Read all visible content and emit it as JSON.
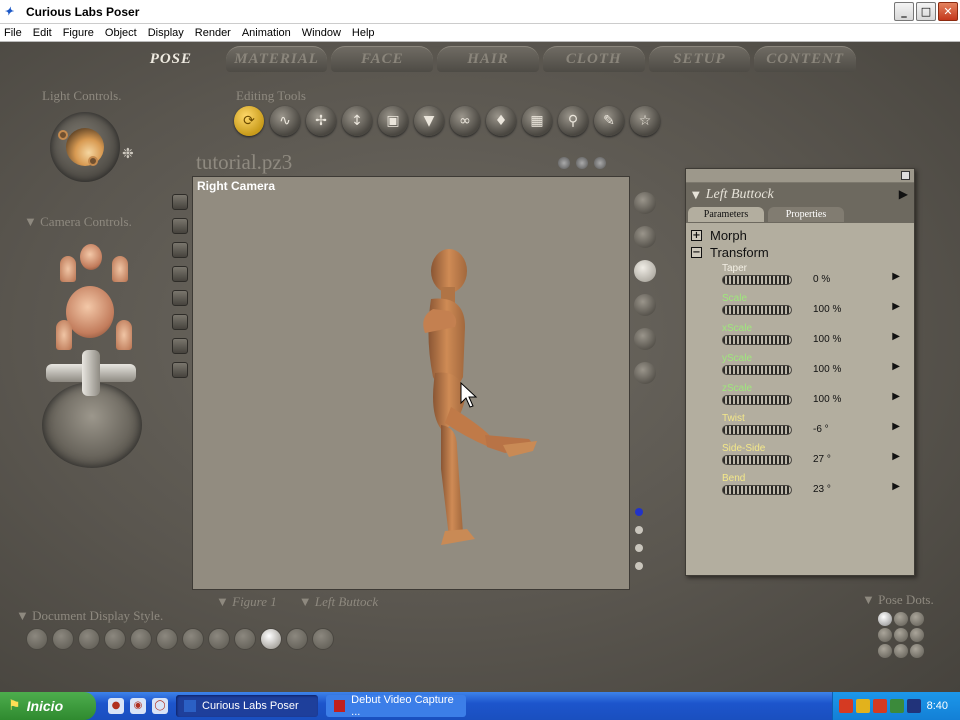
{
  "window": {
    "title": "Curious Labs Poser",
    "app_icon": "poser-icon"
  },
  "menubar": {
    "items": [
      "File",
      "Edit",
      "Figure",
      "Object",
      "Display",
      "Render",
      "Animation",
      "Window",
      "Help"
    ]
  },
  "tabs": [
    "POSE",
    "MATERIAL",
    "FACE",
    "HAIR",
    "CLOTH",
    "SETUP",
    "CONTENT"
  ],
  "active_tab": "POSE",
  "light_controls": {
    "label": "Light Controls."
  },
  "editing_tools": {
    "label": "Editing Tools"
  },
  "camera_controls": {
    "label": "Camera Controls."
  },
  "document": {
    "title": "tutorial.pz3",
    "camera_label": "Right Camera"
  },
  "figure_menu": {
    "figure": "Figure 1",
    "part": "Left Buttock"
  },
  "doc_display_style": {
    "label": "Document Display Style."
  },
  "pose_dots": {
    "label": "Pose Dots."
  },
  "param_panel": {
    "actor": "Left Buttock",
    "tabs": [
      "Parameters",
      "Properties"
    ],
    "sections": [
      {
        "name": "Morph",
        "expanded": false
      },
      {
        "name": "Transform",
        "expanded": true
      }
    ],
    "params": [
      {
        "name": "Taper",
        "value": "0 %",
        "color": "#f3efe4"
      },
      {
        "name": "Scale",
        "value": "100 %",
        "color": "#9fe87b"
      },
      {
        "name": "xScale",
        "value": "100 %",
        "color": "#9fe87b"
      },
      {
        "name": "yScale",
        "value": "100 %",
        "color": "#9fe87b"
      },
      {
        "name": "zScale",
        "value": "100 %",
        "color": "#9fe87b"
      },
      {
        "name": "Twist",
        "value": "-6 °",
        "color": "#f4e889"
      },
      {
        "name": "Side-Side",
        "value": "27 °",
        "color": "#f4e889"
      },
      {
        "name": "Bend",
        "value": "23 °",
        "color": "#f4e889"
      }
    ]
  },
  "taskbar": {
    "start": "Inicio",
    "buttons": [
      {
        "label": "Curious Labs Poser",
        "active": true
      },
      {
        "label": "Debut Video Capture ...",
        "active": false
      }
    ],
    "clock": "8:40"
  }
}
